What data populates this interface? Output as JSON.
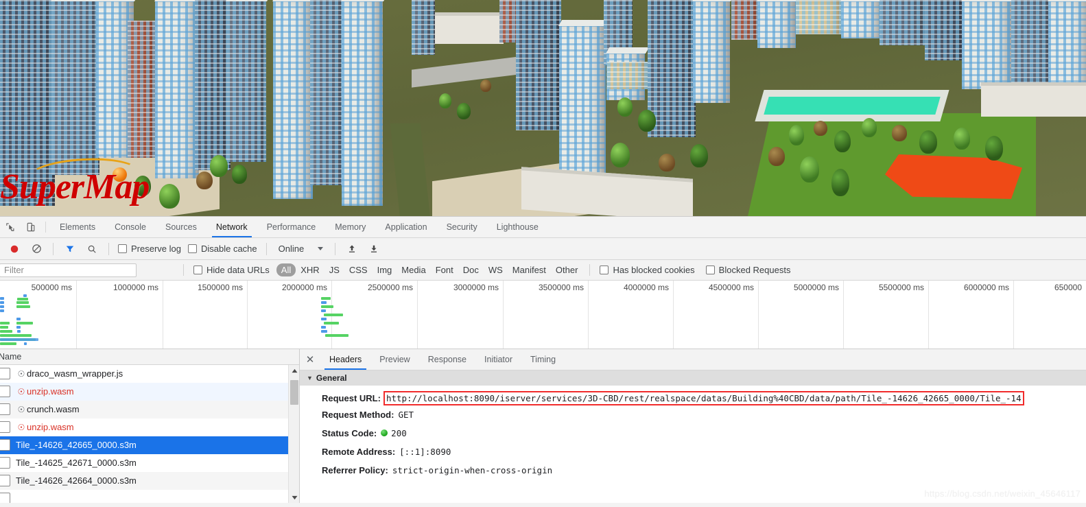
{
  "scene": {
    "logo_text_super": "Super",
    "logo_text_map": "Map",
    "alt": "3D city model viewport"
  },
  "devtools": {
    "tabs": [
      {
        "label": "Elements",
        "active": false
      },
      {
        "label": "Console",
        "active": false
      },
      {
        "label": "Sources",
        "active": false
      },
      {
        "label": "Network",
        "active": true
      },
      {
        "label": "Performance",
        "active": false
      },
      {
        "label": "Memory",
        "active": false
      },
      {
        "label": "Application",
        "active": false
      },
      {
        "label": "Security",
        "active": false
      },
      {
        "label": "Lighthouse",
        "active": false
      }
    ],
    "toolbar": {
      "record_title": "record-button",
      "clear_title": "clear-button",
      "filter_title": "filter-button",
      "search_title": "search-button",
      "preserve_log_label": "Preserve log",
      "preserve_log_checked": false,
      "disable_cache_label": "Disable cache",
      "disable_cache_checked": false,
      "throttling_value": "Online",
      "import_title": "import-har",
      "export_title": "export-har"
    },
    "filterbar": {
      "filter_placeholder": "Filter",
      "filter_value": "",
      "hide_data_urls_label": "Hide data URLs",
      "hide_data_urls_checked": false,
      "types": [
        {
          "label": "All",
          "active": true
        },
        {
          "label": "XHR",
          "active": false
        },
        {
          "label": "JS",
          "active": false
        },
        {
          "label": "CSS",
          "active": false
        },
        {
          "label": "Img",
          "active": false
        },
        {
          "label": "Media",
          "active": false
        },
        {
          "label": "Font",
          "active": false
        },
        {
          "label": "Doc",
          "active": false
        },
        {
          "label": "WS",
          "active": false
        },
        {
          "label": "Manifest",
          "active": false
        },
        {
          "label": "Other",
          "active": false
        }
      ],
      "has_blocked_cookies_label": "Has blocked cookies",
      "has_blocked_cookies_checked": false,
      "blocked_requests_label": "Blocked Requests",
      "blocked_requests_checked": false
    },
    "overview": {
      "tick_labels": [
        "500000 ms",
        "1000000 ms",
        "1500000 ms",
        "2000000 ms",
        "2500000 ms",
        "3000000 ms",
        "3500000 ms",
        "4000000 ms",
        "4500000 ms",
        "5000000 ms",
        "5500000 ms",
        "6000000 ms",
        "650000"
      ],
      "bar_color_request": "#4e9ae8",
      "bar_color_download": "#56d364"
    },
    "request_list": {
      "column_header": "Name",
      "rows": [
        {
          "name": "draco_wasm_wrapper.js",
          "icon": "gear-icon",
          "state": "normal"
        },
        {
          "name": "unzip.wasm",
          "icon": "gear-icon",
          "state": "error"
        },
        {
          "name": "crunch.wasm",
          "icon": "gear-icon",
          "state": "normal"
        },
        {
          "name": "unzip.wasm",
          "icon": "gear-icon",
          "state": "error"
        },
        {
          "name": "Tile_-14626_42665_0000.s3m",
          "icon": "none",
          "state": "selected"
        },
        {
          "name": "Tile_-14625_42671_0000.s3m",
          "icon": "none",
          "state": "normal"
        },
        {
          "name": "Tile_-14626_42664_0000.s3m",
          "icon": "none",
          "state": "normal"
        }
      ]
    },
    "detail": {
      "tabs": [
        {
          "label": "Headers",
          "active": true
        },
        {
          "label": "Preview",
          "active": false
        },
        {
          "label": "Response",
          "active": false
        },
        {
          "label": "Initiator",
          "active": false
        },
        {
          "label": "Timing",
          "active": false
        }
      ],
      "section_title": "General",
      "rows": [
        {
          "label": "Request URL:",
          "value": "http://localhost:8090/iserver/services/3D-CBD/rest/realspace/datas/Building%40CBD/data/path/Tile_-14626_42665_0000/Tile_-14",
          "highlighted": true
        },
        {
          "label": "Request Method:",
          "value": "GET",
          "highlighted": false
        },
        {
          "label": "Status Code:",
          "value": "200",
          "status": "ok",
          "highlighted": false
        },
        {
          "label": "Remote Address:",
          "value": "[::1]:8090",
          "highlighted": false
        },
        {
          "label": "Referrer Policy:",
          "value": "strict-origin-when-cross-origin",
          "highlighted": false
        }
      ]
    }
  },
  "watermark": "https://blog.csdn.net/weixin_45646117",
  "colors": {
    "accent": "#1a73e8",
    "error": "#d93025",
    "highlight_box": "#f12b2b",
    "status_ok": "#19a319",
    "selected_row": "#1a73e8"
  }
}
